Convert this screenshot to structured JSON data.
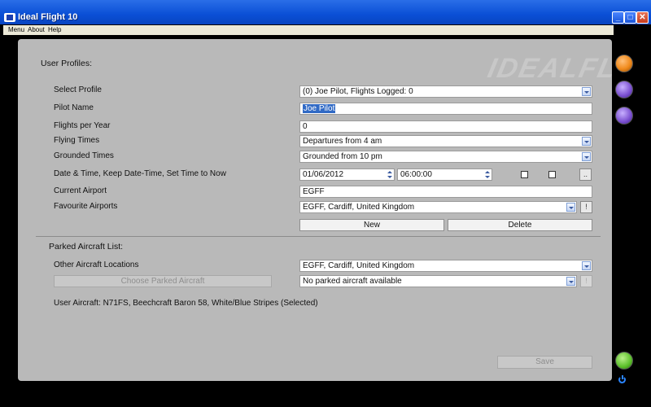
{
  "window": {
    "title": "Ideal Flight 10",
    "controls": {
      "minimize": "_",
      "maximize": "□",
      "close": "✕"
    }
  },
  "menubar": {
    "items": [
      "Menu",
      "About",
      "Help"
    ]
  },
  "watermark": "IDEALFLIGHT",
  "profiles": {
    "section_title": "User Profiles:",
    "select_profile": {
      "label": "Select Profile",
      "value": "(0) Joe Pilot, Flights Logged: 0"
    },
    "pilot_name": {
      "label": "Pilot Name",
      "value": "Joe Pilot"
    },
    "flights_per_year": {
      "label": "Flights per Year",
      "value": "0"
    },
    "flying_times": {
      "label": "Flying Times",
      "value": "Departures from 4 am"
    },
    "grounded_times": {
      "label": "Grounded Times",
      "value": "Grounded from 10 pm"
    },
    "date_time": {
      "label": "Date & Time, Keep Date-Time, Set Time to Now",
      "date": "01/06/2012",
      "time": "06:00:00",
      "set_now_button": ".."
    },
    "current_airport": {
      "label": "Current Airport",
      "value": "EGFF"
    },
    "favourite_airports": {
      "label": "Favourite Airports",
      "value": "EGFF, Cardiff, United Kingdom",
      "info_button": "!"
    },
    "new_button": "New",
    "delete_button": "Delete"
  },
  "parked": {
    "section_title": "Parked Aircraft List:",
    "other_locations": {
      "label": "Other Aircraft Locations",
      "value": "EGFF, Cardiff, United Kingdom"
    },
    "choose_button": "Choose Parked Aircraft",
    "parked_list": {
      "value": "No parked aircraft available",
      "info_button": "!"
    },
    "user_aircraft": "User Aircraft: N71FS, Beechcraft Baron 58, White/Blue Stripes (Selected)"
  },
  "save_button": "Save",
  "colors": {
    "panel": "#b9b9b9",
    "titlebar": "#0a4fd6",
    "selection": "#316ac5",
    "sidebar_orange": "#f08a1c",
    "sidebar_purple": "#7a4fd0",
    "back_green": "#5bbf2a",
    "power_blue": "#2a84ff"
  },
  "sidebar_icons": [
    "folder-icon",
    "user-icon",
    "pilot-icon",
    "back-arrow-icon",
    "power-icon"
  ]
}
